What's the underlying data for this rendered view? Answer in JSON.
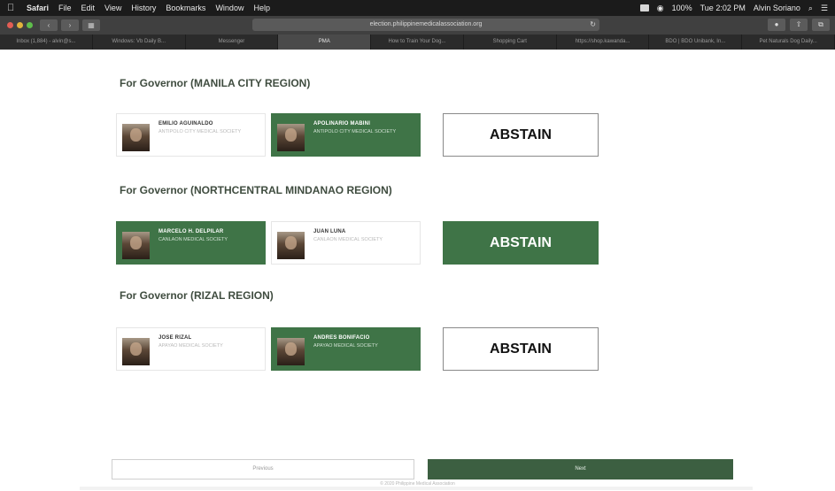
{
  "menubar": {
    "menus": [
      "Safari",
      "File",
      "Edit",
      "View",
      "History",
      "Bookmarks",
      "Window",
      "Help"
    ],
    "battery": "100%",
    "time": "Tue 2:02 PM",
    "user": "Alvin Soriano"
  },
  "browser": {
    "url": "election.philippinemedicalassociation.org",
    "tabs": [
      "Inbox (1,884) - alvin@s...",
      "Windows: Vb Daily B...",
      "Messenger",
      "PMA",
      "How to Train Your Dog...",
      "Shopping Cart",
      "https://shop.kawanda...",
      "BDO | BDO Unibank, In...",
      "Pet Naturals Dog Daily..."
    ],
    "active_tab": 3
  },
  "sections": [
    {
      "title": "For Governor (MANILA CITY REGION)",
      "candidates": [
        {
          "name": "EMILIO AGUINALDO",
          "org": "ANTIPOLO CITY MEDICAL SOCIETY",
          "selected": false
        },
        {
          "name": "APOLINARIO MABINI",
          "org": "ANTIPOLO CITY MEDICAL SOCIETY",
          "selected": true
        }
      ],
      "abstain": {
        "label": "ABSTAIN",
        "selected": false
      }
    },
    {
      "title": "For Governor (NORTHCENTRAL MINDANAO REGION)",
      "candidates": [
        {
          "name": "MARCELO H. DELPILAR",
          "org": "CANLAON MEDICAL SOCIETY",
          "selected": true
        },
        {
          "name": "JUAN LUNA",
          "org": "CANLAON MEDICAL SOCIETY",
          "selected": false
        }
      ],
      "abstain": {
        "label": "ABSTAIN",
        "selected": true
      }
    },
    {
      "title": "For Governor (RIZAL REGION)",
      "candidates": [
        {
          "name": "JOSE RIZAL",
          "org": "APAYAO MEDICAL SOCIETY",
          "selected": false
        },
        {
          "name": "ANDRES BONIFACIO",
          "org": "APAYAO MEDICAL SOCIETY",
          "selected": true
        }
      ],
      "abstain": {
        "label": "ABSTAIN",
        "selected": false
      }
    }
  ],
  "nav": {
    "previous_label": "Previous",
    "next_label": "Next"
  },
  "footer": "© 2020 Philippine Medical Association",
  "colors": {
    "selected_green": "#3f7447",
    "next_button": "#3c5f41",
    "title_text": "#3f4c3f"
  }
}
